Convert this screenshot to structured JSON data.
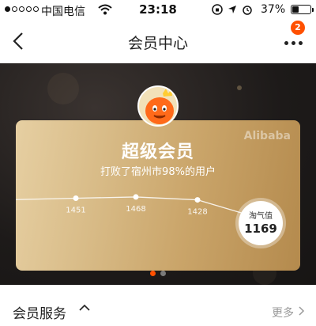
{
  "status_bar": {
    "carrier": "中国电信",
    "time": "23:18",
    "battery_percent": "37%",
    "battery_level": 0.37,
    "signal_bars_filled": 1,
    "signal_bars_total": 5
  },
  "nav": {
    "title": "会员中心",
    "notification_count": "2",
    "icons": {
      "back": "chevron-left-icon",
      "more": "more-dots-icon"
    }
  },
  "card": {
    "brand": "Alibaba",
    "level_title": "超级会员",
    "subtitle": "打败了宿州市98%的用户",
    "score_label": "淘气值",
    "score_value": "1169"
  },
  "pager": {
    "pages": 2,
    "active": 0
  },
  "section": {
    "title": "会员服务",
    "more_label": "更多"
  },
  "colors": {
    "accent": "#ff5000",
    "card_gold": "#d8bb87",
    "hero_bg": "#1d1a19"
  },
  "chart_data": {
    "type": "line",
    "points": [
      {
        "label": "1451",
        "value": 1451
      },
      {
        "label": "1468",
        "value": 1468
      },
      {
        "label": "1428",
        "value": 1428
      },
      {
        "label": "1169",
        "value": 1169
      }
    ]
  }
}
